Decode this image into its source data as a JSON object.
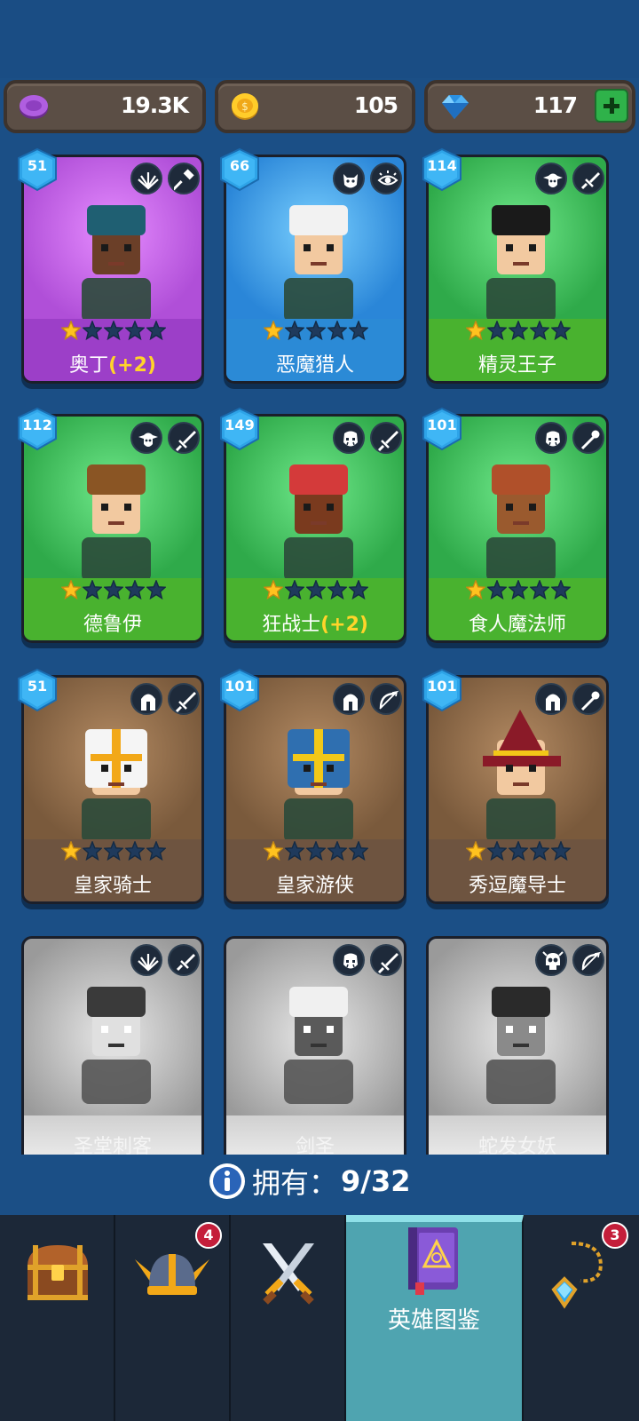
{
  "currencies": {
    "gems_purple": "19.3K",
    "coins": "105",
    "diamonds": "117"
  },
  "heroes": [
    {
      "name": "奥丁",
      "bonus": "(+2)",
      "level": "51",
      "stars": 1,
      "class_icon": "wings-icon",
      "weapon_icon": "hammer-icon",
      "color": "#b04fd8",
      "colorLight": "#e68cff",
      "bar": "#9c3fc8",
      "locked": false
    },
    {
      "name": "恶魔猎人",
      "bonus": "",
      "level": "66",
      "stars": 1,
      "class_icon": "demon-face-icon",
      "weapon_icon": "eye-icon",
      "color": "#2a86d8",
      "colorLight": "#7ad0ff",
      "bar": "#2b8ad6",
      "locked": false
    },
    {
      "name": "精灵王子",
      "bonus": "",
      "level": "114",
      "stars": 1,
      "class_icon": "elf-face-icon",
      "weapon_icon": "dagger-icon",
      "color": "#2faa4a",
      "colorLight": "#6fe88a",
      "bar": "#49b22f",
      "locked": false
    },
    {
      "name": "德鲁伊",
      "bonus": "",
      "level": "112",
      "stars": 1,
      "class_icon": "elf-face-icon",
      "weapon_icon": "sword-icon",
      "color": "#2faa4a",
      "colorLight": "#6fe88a",
      "bar": "#49b22f",
      "locked": false
    },
    {
      "name": "狂战士",
      "bonus": "(+2)",
      "level": "149",
      "stars": 1,
      "class_icon": "orc-face-icon",
      "weapon_icon": "sword-icon",
      "color": "#2faa4a",
      "colorLight": "#6fe88a",
      "bar": "#49b22f",
      "locked": false
    },
    {
      "name": "食人魔法师",
      "bonus": "",
      "level": "101",
      "stars": 1,
      "class_icon": "orc-face-icon",
      "weapon_icon": "staff-icon",
      "color": "#2faa4a",
      "colorLight": "#6fe88a",
      "bar": "#49b22f",
      "locked": false
    },
    {
      "name": "皇家骑士",
      "bonus": "",
      "level": "51",
      "stars": 1,
      "class_icon": "helmet-icon",
      "weapon_icon": "sword-icon",
      "color": "#7a5a3c",
      "colorLight": "#b38a62",
      "bar": "#6e5440",
      "locked": false
    },
    {
      "name": "皇家游侠",
      "bonus": "",
      "level": "101",
      "stars": 1,
      "class_icon": "helmet-icon",
      "weapon_icon": "bow-icon",
      "color": "#7a5a3c",
      "colorLight": "#b38a62",
      "bar": "#6e5440",
      "locked": false
    },
    {
      "name": "秀逗魔导士",
      "bonus": "",
      "level": "101",
      "stars": 1,
      "class_icon": "helmet-icon",
      "weapon_icon": "staff-icon",
      "color": "#7a5a3c",
      "colorLight": "#b38a62",
      "bar": "#6e5440",
      "locked": false
    },
    {
      "name": "圣堂刺客",
      "bonus": "",
      "level": "",
      "stars": 0,
      "class_icon": "wings-icon",
      "weapon_icon": "dagger-icon",
      "color": "#9a9a9a",
      "colorLight": "#e8e8e8",
      "bar": "#bdbdbd",
      "locked": true
    },
    {
      "name": "剑圣",
      "bonus": "",
      "level": "",
      "stars": 0,
      "class_icon": "orc-face-icon",
      "weapon_icon": "sword-icon",
      "color": "#9a9a9a",
      "colorLight": "#e8e8e8",
      "bar": "#bdbdbd",
      "locked": true
    },
    {
      "name": "蛇发女妖",
      "bonus": "",
      "level": "",
      "stars": 0,
      "class_icon": "skull-icon",
      "weapon_icon": "bow-icon",
      "color": "#9a9a9a",
      "colorLight": "#e8e8e8",
      "bar": "#bdbdbd",
      "locked": true
    }
  ],
  "owned": {
    "label": "拥有：",
    "value": "9/32"
  },
  "nav": {
    "items": [
      {
        "id": "chest",
        "icon": "treasure-chest-icon",
        "label": "",
        "badge": ""
      },
      {
        "id": "heroes",
        "icon": "viking-helmet-icon",
        "label": "",
        "badge": "4"
      },
      {
        "id": "battle",
        "icon": "crossed-swords-icon",
        "label": "",
        "badge": ""
      },
      {
        "id": "codex",
        "icon": "spellbook-icon",
        "label": "英雄图鉴",
        "badge": ""
      },
      {
        "id": "amulet",
        "icon": "amulet-icon",
        "label": "",
        "badge": "3"
      }
    ]
  }
}
